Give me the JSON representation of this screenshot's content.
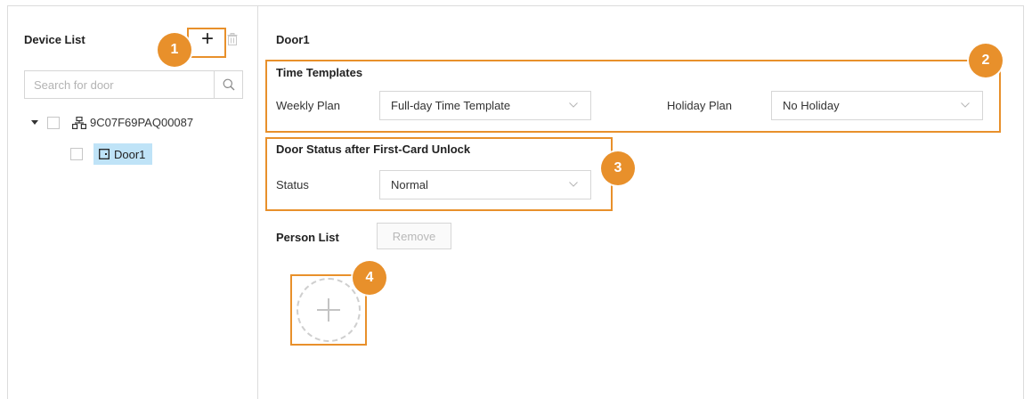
{
  "left": {
    "title": "Device List",
    "add_icon": "plus-icon",
    "delete_icon": "trash-icon",
    "search": {
      "placeholder": "Search for door",
      "value": ""
    },
    "tree": {
      "device": {
        "label": "9C07F69PAQ00087",
        "icon": "network-device-icon",
        "expanded": true
      },
      "door": {
        "label": "Door1",
        "icon": "door-icon",
        "selected": true
      }
    }
  },
  "main": {
    "title": "Door1",
    "time_templates": {
      "title": "Time Templates",
      "weekly_label": "Weekly Plan",
      "weekly_value": "Full-day Time Template",
      "holiday_label": "Holiday Plan",
      "holiday_value": "No Holiday"
    },
    "door_status": {
      "title": "Door Status after First-Card Unlock",
      "status_label": "Status",
      "status_value": "Normal"
    },
    "person_list": {
      "title": "Person List",
      "remove_label": "Remove"
    }
  },
  "badges": [
    "1",
    "2",
    "3",
    "4"
  ],
  "colors": {
    "accent": "#e8902b",
    "selection": "#bfe3f7",
    "border": "#dcdcdc"
  }
}
